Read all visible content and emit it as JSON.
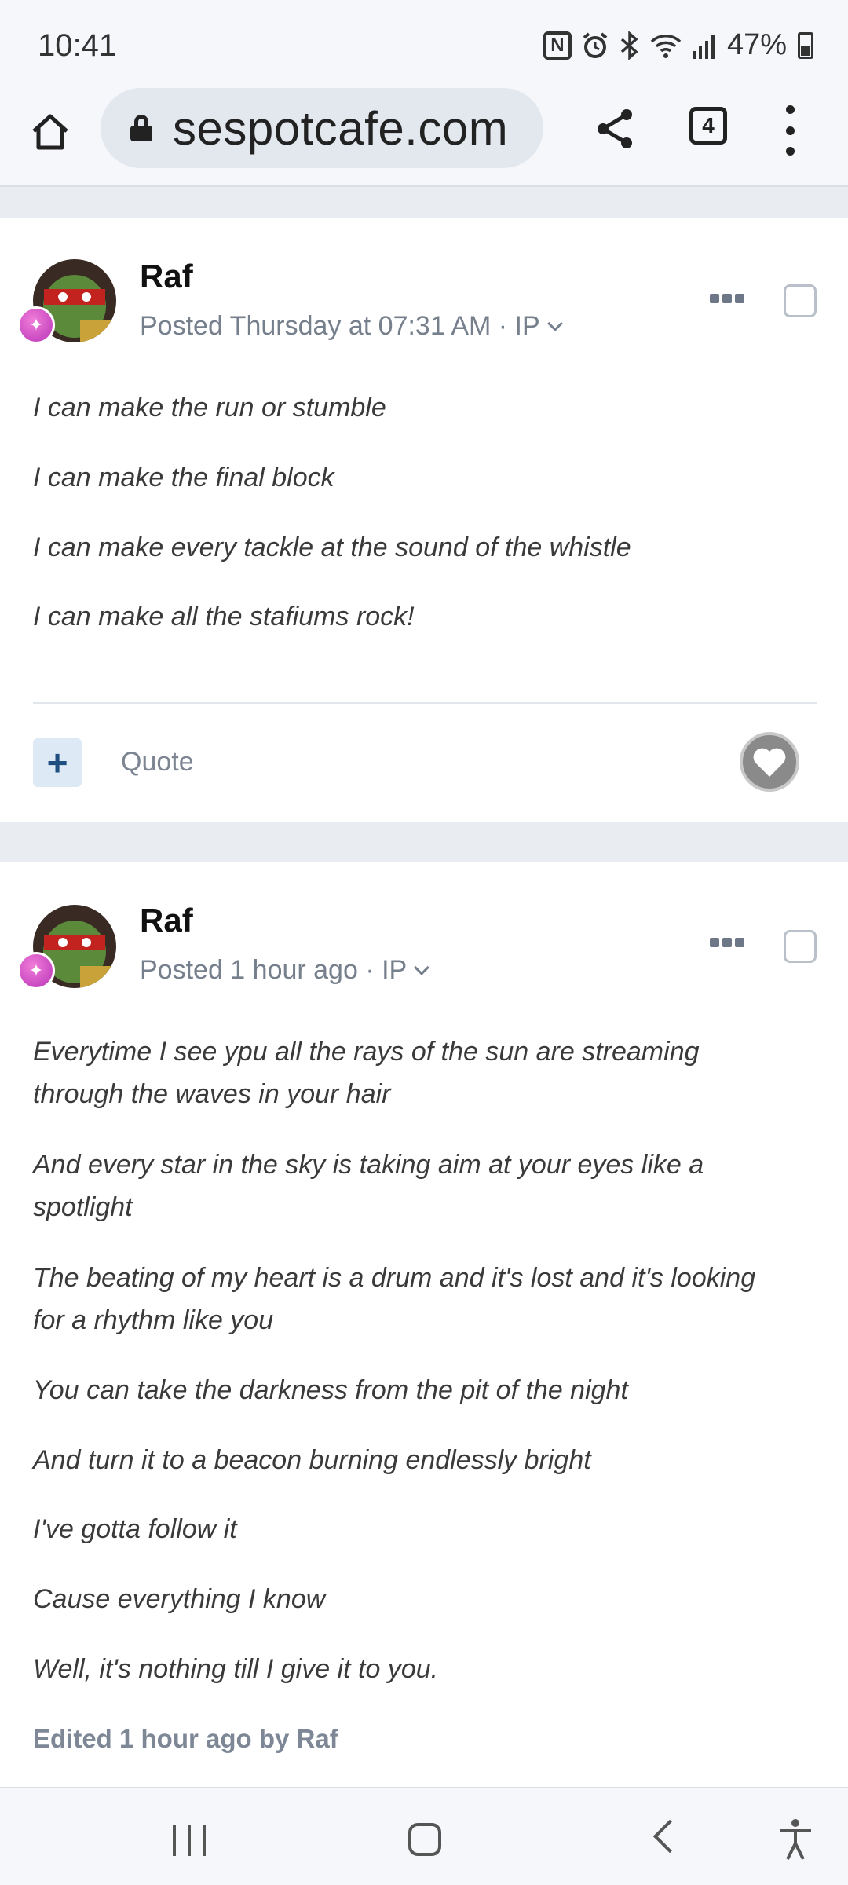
{
  "status_bar": {
    "time": "10:41",
    "battery": "47%",
    "icons": [
      "nfc-icon",
      "alarm-icon",
      "bluetooth-icon",
      "wifi-icon",
      "signal-icon",
      "battery-icon"
    ]
  },
  "browser": {
    "url": "sespotcafe.com",
    "tab_count": "4"
  },
  "posts": [
    {
      "author": "Raf",
      "meta": "Posted Thursday at 07:31 AM · IP",
      "lines": [
        "I can make the run or stumble",
        "I can make the final block",
        "I can make every tackle at the sound of the whistle",
        "I can make all the stafiums rock!"
      ],
      "quote_label": "Quote"
    },
    {
      "author": "Raf",
      "meta": "Posted 1 hour ago · IP",
      "lines": [
        "Everytime I see ypu all the rays of the sun are streaming",
        "through the waves in your hair",
        "And every star in the sky is taking aim at your eyes like a",
        "spotlight",
        "The beating of my heart is a drum and it's lost and it's looking",
        "for a rhythm like you",
        "You can take the darkness from the pit of the night",
        "And turn it to a beacon burning endlessly bright",
        "I've gotta follow it",
        "Cause everything I know",
        "Well, it's nothing till I give it to you."
      ],
      "edited": "Edited 1 hour ago by Raf"
    }
  ]
}
